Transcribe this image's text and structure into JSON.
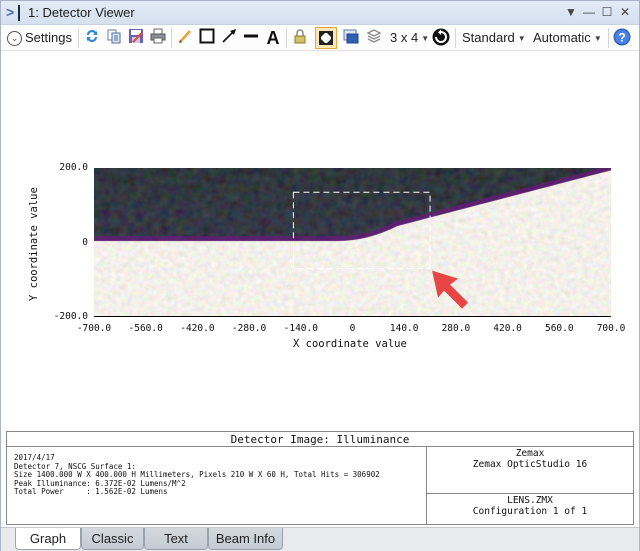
{
  "window": {
    "title": "1: Detector Viewer",
    "controls": [
      "dropdown",
      "minimize",
      "maximize",
      "close"
    ]
  },
  "toolbar": {
    "settings_label": "Settings",
    "layout_label": "3 x 4",
    "standard_label": "Standard",
    "automatic_label": "Automatic",
    "icons": [
      "refresh-icon",
      "copy-icon",
      "save-icon",
      "print-icon",
      "pencil-icon",
      "rectangle-icon",
      "arrow-icon",
      "line-icon",
      "text-icon",
      "lock-icon",
      "fit-icon",
      "window-icon",
      "layers-icon",
      "rotate-icon",
      "help-icon"
    ]
  },
  "plot": {
    "xlabel": "X coordinate value",
    "ylabel": "Y coordinate value",
    "xticks": [
      "-700.0",
      "-560.0",
      "-420.0",
      "-280.0",
      "-140.0",
      "0",
      "140.0",
      "280.0",
      "420.0",
      "560.0",
      "700.0"
    ],
    "yticks": [
      "200.0",
      "0",
      "-200.0"
    ],
    "xrange": [
      -700,
      700
    ],
    "yrange": [
      -200,
      200
    ],
    "selection_box": {
      "x_min": -160,
      "x_max": 210,
      "y_min": -70,
      "y_max": 135
    },
    "colors": {
      "dark": "#050505",
      "purple": "#4a0a5a",
      "bright": "#d8cfb4",
      "selection": "#ffffff",
      "arrow": "#e84545"
    }
  },
  "info": {
    "title": "Detector Image: Illuminance",
    "lines": [
      "2017/4/17",
      "Detector 7, NSCG Surface 1:",
      "Size 1400.000 W X 400.000 H Millimeters, Pixels 210 W X 60 H, Total Hits = 306902",
      "Peak Illuminance: 6.372E-02 Lumens/M^2",
      "Total Power     : 1.562E-02 Lumens"
    ],
    "company_line1": "Zemax",
    "company_line2": "Zemax OpticStudio 16",
    "file_line1": "LENS.ZMX",
    "file_line2": "Configuration 1 of 1"
  },
  "tabs": [
    {
      "label": "Graph",
      "active": true
    },
    {
      "label": "Classic",
      "active": false
    },
    {
      "label": "Text",
      "active": false
    },
    {
      "label": "Beam Info",
      "active": false
    }
  ]
}
